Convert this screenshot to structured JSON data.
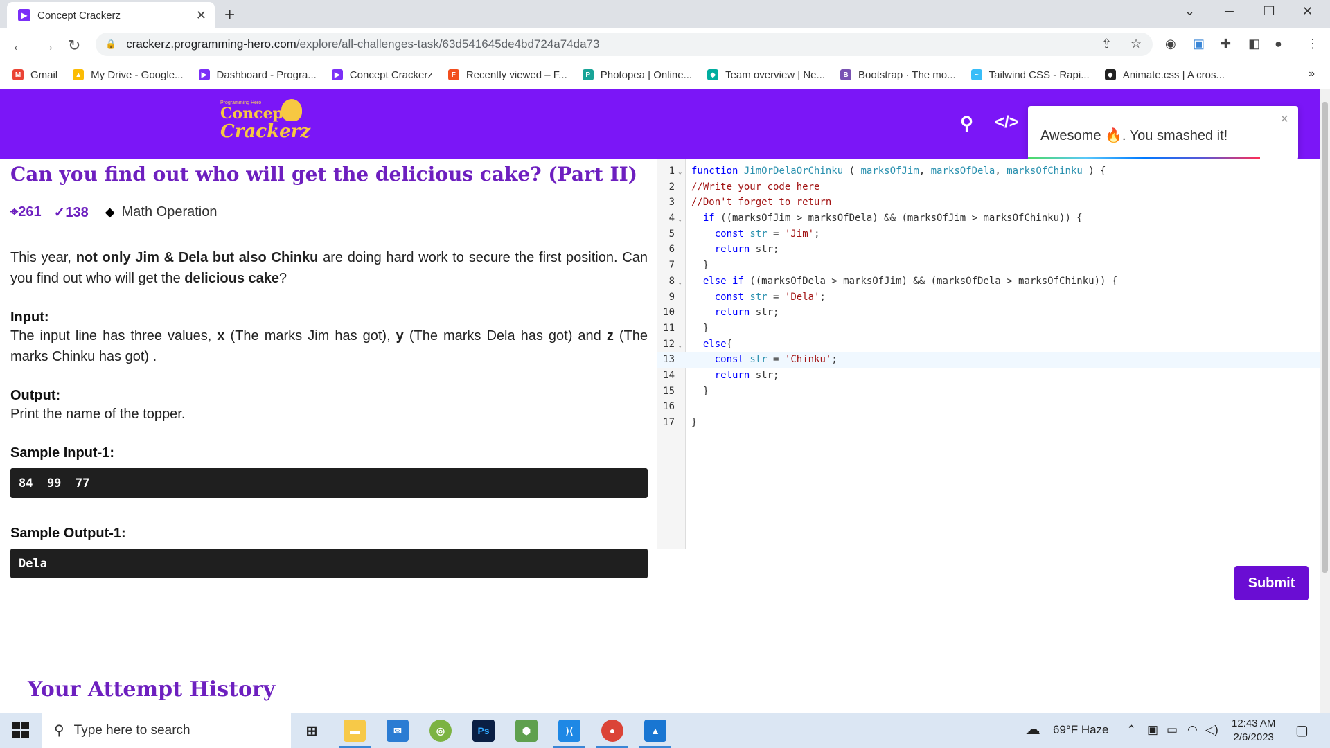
{
  "browser": {
    "tab_title": "Concept Crackerz",
    "url_host": "crackerz.programming-hero.com",
    "url_path": "/explore/all-challenges-task/63d541645de4bd724a74da73",
    "bookmarks": [
      {
        "label": "Gmail",
        "color": "#ea4335",
        "glyph": "M"
      },
      {
        "label": "My Drive - Google...",
        "color": "#fbbc04",
        "glyph": "▲"
      },
      {
        "label": "Dashboard - Progra...",
        "color": "#7b2ff7",
        "glyph": "▶"
      },
      {
        "label": "Concept Crackerz",
        "color": "#7b2ff7",
        "glyph": "▶"
      },
      {
        "label": "Recently viewed – F...",
        "color": "#f24e1e",
        "glyph": "F"
      },
      {
        "label": "Photopea | Online...",
        "color": "#18a497",
        "glyph": "P"
      },
      {
        "label": "Team overview | Ne...",
        "color": "#00ad9f",
        "glyph": "◆"
      },
      {
        "label": "Bootstrap · The mo...",
        "color": "#7952b3",
        "glyph": "B"
      },
      {
        "label": "Tailwind CSS - Rapi...",
        "color": "#38bdf8",
        "glyph": "~"
      },
      {
        "label": "Animate.css | A cros...",
        "color": "#222222",
        "glyph": "◆"
      }
    ],
    "bookmarks_more": "»"
  },
  "site": {
    "logo_small": "Programming Hero",
    "logo_line1": "Concept",
    "logo_line2": "Crackerz"
  },
  "toast": {
    "message": "Awesome 🔥. You smashed it!",
    "close": "×"
  },
  "problem": {
    "title": "Can you find out who will get the delicious cake? (Part II)",
    "attempts": "261",
    "solved": "138",
    "tag": "Math Operation",
    "desc_1": "This year, ",
    "desc_bold_1": "not only Jim & Dela but also Chinku",
    "desc_2": " are doing hard work to secure the first position. Can you find out who will get the ",
    "desc_bold_2": "delicious cake",
    "desc_3": "?",
    "input_label": "Input:",
    "input_1": "The input line has three values, ",
    "input_x": "x",
    "input_2": " (The marks Jim has got), ",
    "input_y": "y",
    "input_3": " (The marks Dela has got) and ",
    "input_z": "z",
    "input_4": " (The marks Chinku has got) .",
    "output_label": "Output:",
    "output_text": "Print the name of the topper.",
    "sample_input_label": "Sample Input-1:",
    "sample_input": "84  99  77",
    "sample_output_label": "Sample Output-1:",
    "sample_output": "Dela"
  },
  "attempt_history": "Your Attempt History",
  "editor": {
    "active_line": 13,
    "lines": [
      {
        "n": "1",
        "fold": true
      },
      {
        "n": "2",
        "fold": false
      },
      {
        "n": "3",
        "fold": false
      },
      {
        "n": "4",
        "fold": true
      },
      {
        "n": "5",
        "fold": false
      },
      {
        "n": "6",
        "fold": false
      },
      {
        "n": "7",
        "fold": false
      },
      {
        "n": "8",
        "fold": true
      },
      {
        "n": "9",
        "fold": false
      },
      {
        "n": "10",
        "fold": false
      },
      {
        "n": "11",
        "fold": false
      },
      {
        "n": "12",
        "fold": true
      },
      {
        "n": "13",
        "fold": false
      },
      {
        "n": "14",
        "fold": false
      },
      {
        "n": "15",
        "fold": false
      },
      {
        "n": "16",
        "fold": false
      },
      {
        "n": "17",
        "fold": false
      }
    ]
  },
  "submit_label": "Submit",
  "taskbar": {
    "search_placeholder": "Type here to search",
    "weather": "69°F  Haze",
    "time": "12:43 AM",
    "date": "2/6/2023"
  }
}
